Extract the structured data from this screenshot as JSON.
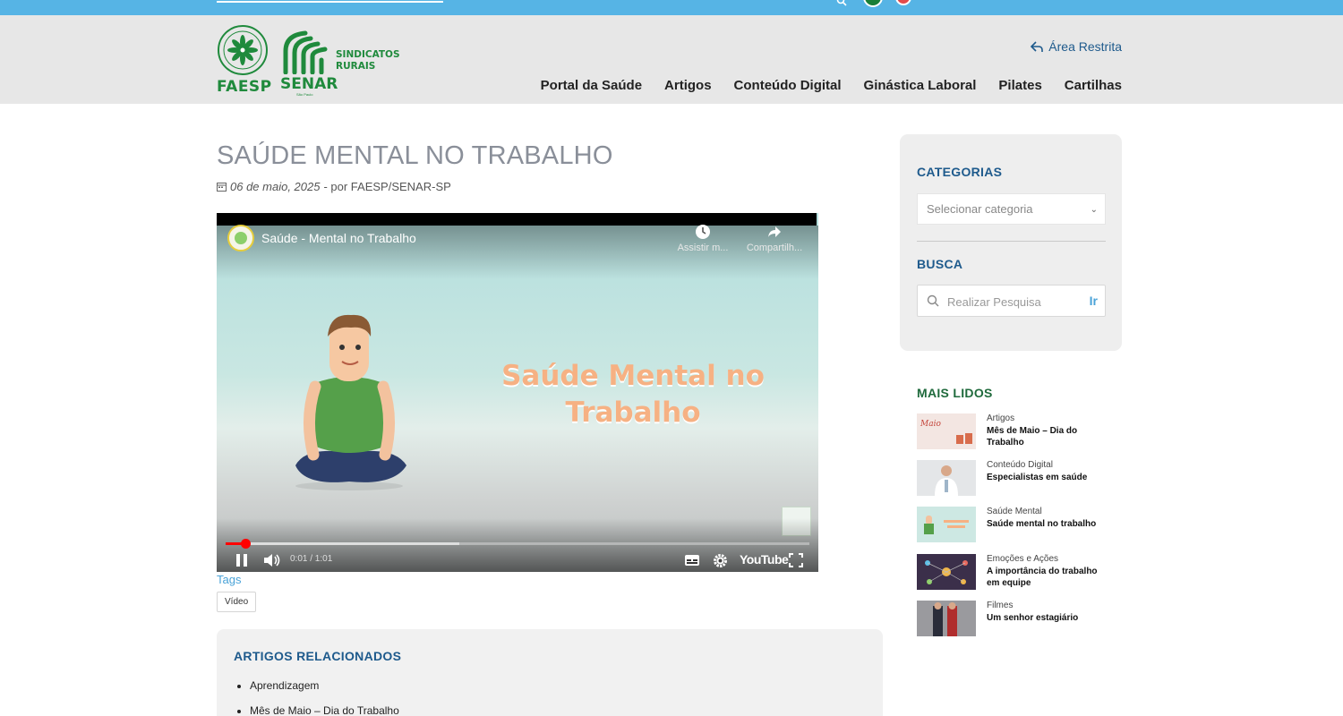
{
  "topbar": {
    "search_icon": "search-icon",
    "flags": [
      "brazil-flag-icon",
      "usa-flag-icon"
    ]
  },
  "header": {
    "logos": {
      "faesp": "FAESP",
      "senar": "SENAR",
      "senar_sub": "São Paulo",
      "sindicatos_line1": "SINDICATOS",
      "sindicatos_line2": "RURAIS"
    },
    "restricted_area": "Área Restrita",
    "nav": [
      "Portal da Saúde",
      "Artigos",
      "Conteúdo Digital",
      "Ginástica Laboral",
      "Pilates",
      "Cartilhas"
    ]
  },
  "article": {
    "title": "SAÚDE MENTAL NO TRABALHO",
    "date": "06 de maio, 2025",
    "byline": " - por FAESP/SENAR-SP",
    "tags_label": "Tags",
    "tags": [
      "Vídeo"
    ]
  },
  "video": {
    "title": "Saúde - Mental no Trabalho",
    "watch_later": "Assistir m...",
    "share": "Compartilh...",
    "overlay_line1": "Saúde Mental no",
    "overlay_line2": "Trabalho",
    "time": "0:01 / 1:01",
    "youtube_label": "YouTube",
    "progress_played": 0.033,
    "progress_loaded": 0.4
  },
  "related": {
    "heading": "ARTIGOS RELACIONADOS",
    "items": [
      "Aprendizagem",
      "Mês de Maio – Dia do Trabalho"
    ]
  },
  "sidebar": {
    "categories_heading": "CATEGORIAS",
    "category_select": "Selecionar categoria",
    "search_heading": "BUSCA",
    "search_placeholder": "Realizar Pesquisa",
    "search_go": "Ir",
    "most_read_heading": "MAIS LIDOS",
    "most_read": [
      {
        "category": "Artigos",
        "title": "Mês de Maio – Dia do Trabalho"
      },
      {
        "category": "Conteúdo Digital",
        "title": "Especialistas em saúde"
      },
      {
        "category": "Saúde Mental",
        "title": "Saúde mental no trabalho"
      },
      {
        "category": "Emoções e Ações",
        "title": "A importância do trabalho em equipe"
      },
      {
        "category": "Filmes",
        "title": "Um senhor estagiário"
      }
    ]
  },
  "colors": {
    "topbar": "#56b4e5",
    "header_bg": "#e7e7e7",
    "brand_green": "#1f8a3c",
    "heading_blue": "#1e5a8c",
    "link_blue": "#4aa3d8",
    "title_gray": "#8a8f99"
  }
}
